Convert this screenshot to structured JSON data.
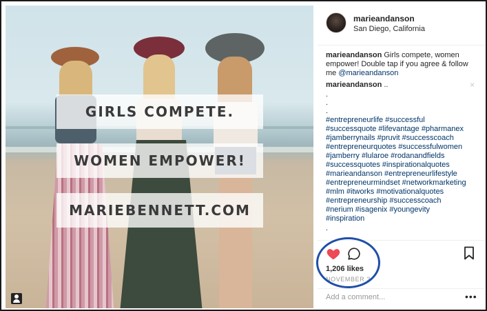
{
  "post": {
    "image_overlay": {
      "line1": "GIRLS COMPETE.",
      "line2": "WOMEN EMPOWER!",
      "line3": "MARIEBENNETT.COM"
    }
  },
  "header": {
    "username": "marieandanson",
    "location": "San Diego, California"
  },
  "caption": {
    "username": "marieandanson",
    "text": " Girls compete, women empower! Double tap if you agree & follow me ",
    "mention": "@marieandanson"
  },
  "comment": {
    "username": "marieandanson",
    "text": " ..",
    "close": "×"
  },
  "dot_lines": [
    ".",
    ".",
    "."
  ],
  "hashtag_lines": [
    "#entrepreneurlife #successful",
    "#successquote #lifevantage #pharmanex",
    "#jamberrynails #pruvit #successcoach",
    "#entrepreneurquotes #successfulwomen",
    "#jamberry #lularoe #rodanandfields",
    "#successquotes #inspirationalquotes",
    "#marieandanson #entrepreneurlifestyle",
    "#entrepreneurmindset #networkmarketing",
    "#mlm #itworks #motivationalquotes",
    "#entrepreneurship #successcoach",
    "#nerium #isagenix #youngevity",
    "#inspiration"
  ],
  "tail_dot": ".",
  "actions": {
    "likes": "1,206 likes",
    "date": "NOVEMBER 3",
    "liked": true,
    "heart_color": "#ed4956",
    "highlight_color": "#1f4fa8"
  },
  "add_comment": {
    "placeholder": "Add a comment...",
    "more": "•••"
  },
  "icons": [
    "user-tag-icon",
    "heart-icon",
    "comment-icon",
    "bookmark-icon",
    "close-icon",
    "more-options-icon"
  ]
}
